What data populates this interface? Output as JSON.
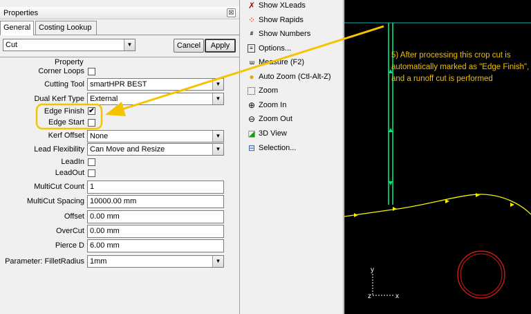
{
  "panel": {
    "title": "Properties",
    "close_glyph": "⊠",
    "tabs": [
      {
        "label": "General"
      },
      {
        "label": "Costing Lookup"
      }
    ],
    "selector_value": "Cut",
    "cancel_label": "Cancel",
    "apply_label": "Apply",
    "property_header": "Property"
  },
  "props": {
    "corner_loops": {
      "label": "Corner Loops",
      "checked": false
    },
    "cutting_tool": {
      "label": "Cutting Tool",
      "value": "smartHPR BEST"
    },
    "dual_kerf": {
      "label": "Dual Kerf Type",
      "value": "External"
    },
    "edge_finish": {
      "label": "Edge Finish",
      "checked": true,
      "mark": "✔"
    },
    "edge_start": {
      "label": "Edge Start",
      "checked": false
    },
    "kerf_offset": {
      "label": "Kerf Offset",
      "value": "None"
    },
    "lead_flex": {
      "label": "Lead Flexibility",
      "value": "Can Move and Resize"
    },
    "leadin": {
      "label": "LeadIn",
      "checked": false
    },
    "leadout": {
      "label": "LeadOut",
      "checked": false
    },
    "multicut_count": {
      "label": "MultiCut Count",
      "value": "1"
    },
    "multicut_spacing": {
      "label": "MultiCut Spacing",
      "value": "10000.00 mm"
    },
    "offset": {
      "label": "Offset",
      "value": "0.00 mm"
    },
    "overcut": {
      "label": "OverCut",
      "value": "0.00 mm"
    },
    "pierce": {
      "label": "Pierce D",
      "value": "6.00 mm"
    },
    "fillet": {
      "label": "Parameter: FilletRadius",
      "value": "1mm"
    }
  },
  "menu": {
    "items": [
      {
        "label": "Show XLeads",
        "icon": "xleads-icon"
      },
      {
        "label": "Show Rapids",
        "icon": "rapids-icon"
      },
      {
        "label": "Show Numbers",
        "icon": "numbers-icon"
      },
      {
        "label": "Options...",
        "icon": "options-icon"
      },
      {
        "label": "Measure (F2)",
        "icon": "measure-icon"
      },
      {
        "label": "Auto Zoom (Ctl-Alt-Z)",
        "icon": "lightbulb-icon"
      },
      {
        "label": "Zoom",
        "icon": "zoom-window-icon"
      },
      {
        "label": "Zoom In",
        "icon": "zoom-in-icon"
      },
      {
        "label": "Zoom Out",
        "icon": "zoom-out-icon"
      },
      {
        "label": "3D View",
        "icon": "3d-view-icon"
      },
      {
        "label": "Selection...",
        "icon": "selection-icon"
      }
    ]
  },
  "canvas": {
    "note": "5) After processing this crop cut is automatically marked as \"Edge Finish\", and a runoff cut is performed",
    "axis_y": "y",
    "axis_x": "x",
    "axis_z": "z",
    "colors": {
      "background": "#000000",
      "path": "#f0f000",
      "crop_cut": "#00e878",
      "annotation": "#f5c400",
      "circle": "#d01818",
      "guide": "#00c0c0"
    }
  }
}
